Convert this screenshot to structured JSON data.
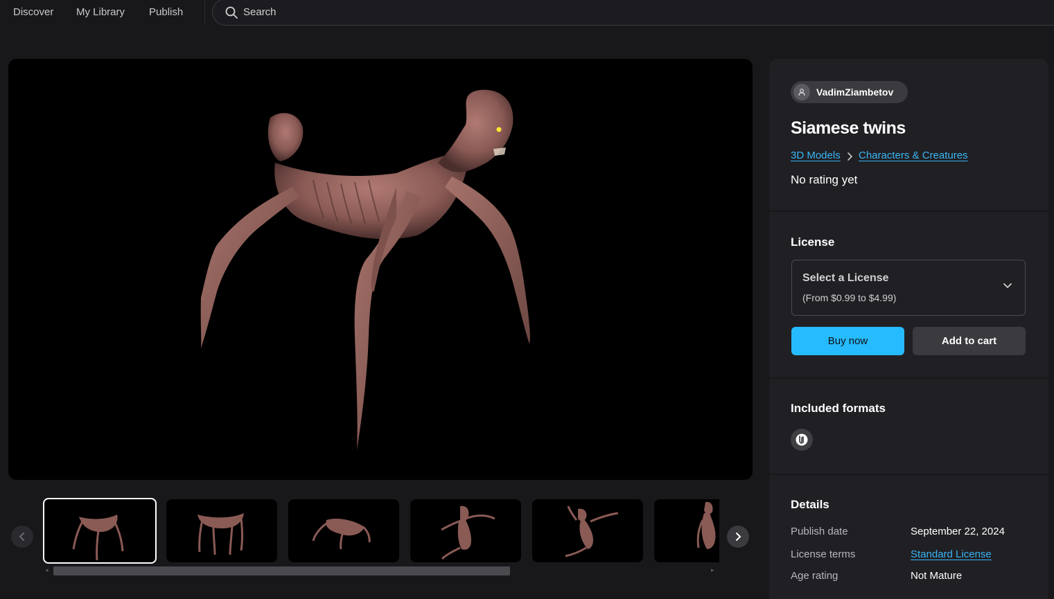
{
  "nav": {
    "items": [
      {
        "label": "Discover"
      },
      {
        "label": "My Library"
      },
      {
        "label": "Publish"
      }
    ],
    "search_placeholder": "Search"
  },
  "seller": {
    "name": "VadimZiambetov"
  },
  "product": {
    "title": "Siamese twins",
    "breadcrumb": [
      "3D Models",
      "Characters & Creatures"
    ],
    "rating_text": "No rating yet"
  },
  "license": {
    "heading": "License",
    "select_title": "Select a License",
    "select_range": "(From $0.99 to $4.99)",
    "buy_label": "Buy now",
    "cart_label": "Add to cart"
  },
  "formats": {
    "heading": "Included formats",
    "items": [
      {
        "icon": "unreal-engine-icon"
      }
    ]
  },
  "details": {
    "heading": "Details",
    "rows": [
      {
        "label": "Publish date",
        "value": "September 22, 2024"
      },
      {
        "label": "License terms",
        "value": "Standard License"
      },
      {
        "label": "Age rating",
        "value": "Not Mature"
      }
    ]
  },
  "gallery": {
    "thumbnails": 6,
    "selected_index": 0
  },
  "colors": {
    "accent": "#26bbff",
    "link": "#38b6f5",
    "background": "#18181b",
    "panel": "#202024"
  }
}
